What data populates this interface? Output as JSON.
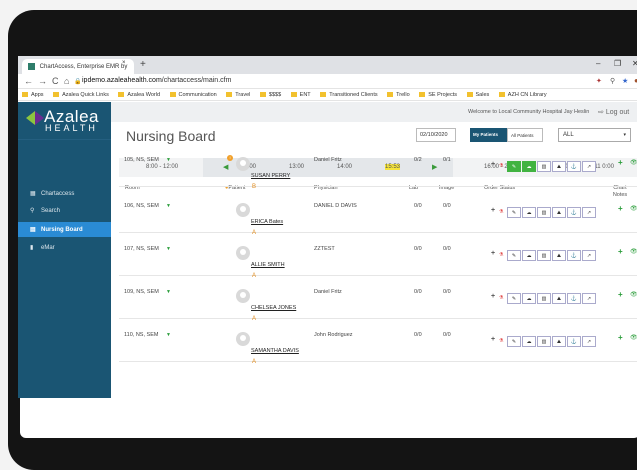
{
  "browser": {
    "tab_title": "ChartAccess, Enterprise EMR by",
    "tab_close": "×",
    "new_tab": "+",
    "url_domain": "ipdemo.azaleahealth.com",
    "url_path": "/chartaccess/main.cfm",
    "bookmarks": [
      "Apps",
      "Azalea Quick Links",
      "Azalea World",
      "Communication",
      "Travel",
      "$$$$",
      "ENT",
      "Transitioned Clients",
      "Trello",
      "SE Projects",
      "Sales",
      "AZH CN Library"
    ]
  },
  "app": {
    "logo_text": "Azalea",
    "logo_sub": "HEALTH",
    "welcome": "Welcome to Local Community Hospital  Jay Heslin",
    "logout": "Log out",
    "sidebar": [
      {
        "label": "Chartaccess",
        "icon": "grid-icon"
      },
      {
        "label": "Search",
        "icon": "search-icon"
      },
      {
        "label": "Nursing Board",
        "icon": "list-icon",
        "active": true
      },
      {
        "label": "eMar",
        "icon": "emar-icon"
      }
    ],
    "page_title": "Nursing Board",
    "date": "02/10/2020",
    "toggle_my": "My Patients",
    "toggle_all": "All Patients",
    "filter_select": "ALL"
  },
  "timeline": {
    "range_left": "8:00 - 12:00",
    "ticks": [
      "12:00",
      "13:00",
      "14:00"
    ],
    "now_prefix": "15:",
    "now_highlight": "15:53",
    "range_mid": "16:00 - 20:00",
    "range_right": "20:00 - Feb 11 0:00"
  },
  "columns": {
    "room": "Room",
    "patient": "Patient",
    "physician": "Physician",
    "lab": "Lab",
    "image": "Image",
    "order_status": "Order Status",
    "chart_notes": "Chart Notes"
  },
  "rows": [
    {
      "room": "105, NS, SEM",
      "patient": "SUSAN PERRY",
      "acuity": "B",
      "physician": "Daniel Fritz",
      "lab": "0/2",
      "image": "0/1",
      "warning": true
    },
    {
      "room": "106, NS, SEM",
      "patient": "ERICA Bates",
      "acuity": "A",
      "physician": "DANIEL D DAVIS",
      "lab": "0/0",
      "image": "0/0"
    },
    {
      "room": "107, NS, SEM",
      "patient": "ALLIE SMITH",
      "acuity": "A",
      "physician": "ZZTEST",
      "lab": "0/0",
      "image": "0/0"
    },
    {
      "room": "109, NS, SEM",
      "patient": "CHELSEA JONES",
      "acuity": "A",
      "physician": "Daniel Fritz",
      "lab": "0/0",
      "image": "0/0"
    },
    {
      "room": "110, NS, SEM",
      "patient": "SAMANTHA DAVIS",
      "acuity": "A",
      "physician": "John Rodriguez",
      "lab": "0/0",
      "image": "0/0"
    }
  ]
}
